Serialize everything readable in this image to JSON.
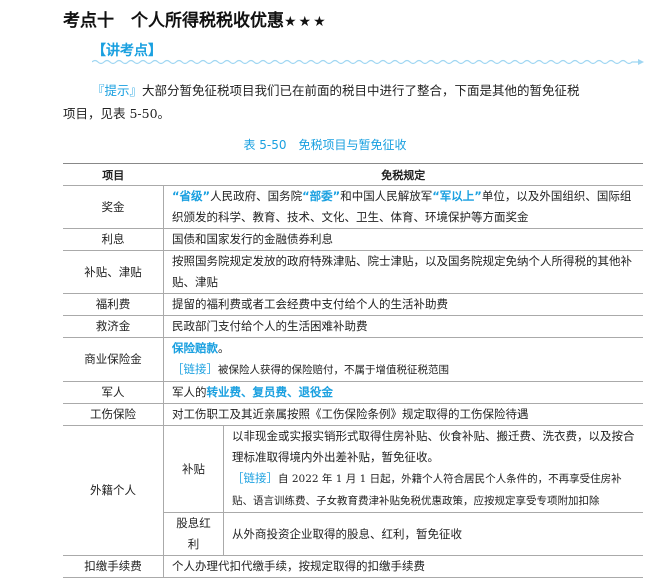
{
  "title": "考点十　个人所得税税收优惠",
  "stars": "★★★",
  "section": "【讲考点】",
  "tip_label": "『提示』",
  "tip_text": "大部分暂免征税项目我们已在前面的税目中进行了整合，下面是其他的暂免征税",
  "tip_text2": "项目，见表 5-50。",
  "caption": "表 5-50　免税项目与暂免征收",
  "table": {
    "headers": [
      "项目",
      "免税规定"
    ],
    "r0": {
      "item": "奖金",
      "q1": "“省级”",
      "t1": "人民政府、国务院",
      "q2": "“部委”",
      "t2": "和中国人民解放军",
      "q3": "“军以上”",
      "t3": "单位，以及外国组织、国际组织颁发的科学、教育、技术、文化、卫生、体育、环境保护等方面奖金"
    },
    "r1": {
      "item": "利息",
      "text": "国债和国家发行的金融债券利息"
    },
    "r2": {
      "item": "补贴、津贴",
      "text": "按照国务院规定发放的政府特殊津贴、院士津贴，以及国务院规定免纳个人所得税的其他补贴、津贴"
    },
    "r3": {
      "item": "福利费",
      "text": "提留的福利费或者工会经费中支付给个人的生活补助费"
    },
    "r4": {
      "item": "救济金",
      "text": "民政部门支付给个人的生活困难补助费"
    },
    "r5": {
      "item": "商业保险金",
      "bold": "保险赔款",
      "end": "。",
      "link": "［链接］",
      "link_text": "被保险人获得的保险赔付，不属于增值税征税范围"
    },
    "r6": {
      "item": "军人",
      "t1": "军人的",
      "bold": "转业费、复员费、退役金"
    },
    "r7": {
      "item": "工伤保险",
      "text": "对工伤职工及其近亲属按照《工伤保险条例》规定取得的工伤保险待遇"
    },
    "r8": {
      "item": "外籍个人",
      "sub1": "补贴",
      "text1": "以非现金或实报实销形式取得住房补贴、伙食补贴、搬迁费、洗衣费，以及按合理标准取得境内外出差补贴，暂免征收。",
      "link": "［链接］",
      "link_text": "自 2022 年 1 月 1 日起，外籍个人符合居民个人条件的，不再享受住房补贴、语言训练费、子女教育费津补贴免税优惠政策，应按规定享受专项附加扣除",
      "sub2": "股息红利",
      "text2": "从外商投资企业取得的股息、红利，暂免征收"
    },
    "r9": {
      "item": "扣缴手续费",
      "text": "个人办理代扣代缴手续，按规定取得的扣缴手续费"
    }
  }
}
